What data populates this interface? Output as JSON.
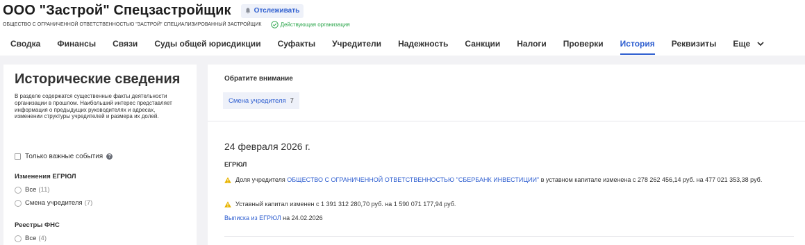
{
  "header": {
    "company_title": "ООО \"Застрой\" Спецзастройщик",
    "follow_label": "Отслеживать",
    "full_name": "ОБЩЕСТВО С ОГРАНИЧЕННОЙ ОТВЕТСТВЕННОСТЬЮ \"ЗАСТРОЙ\" СПЕЦИАЛИЗИРОВАННЫЙ ЗАСТРОЙЩИК",
    "status": "Действующая организация"
  },
  "nav": {
    "tabs": [
      {
        "label": "Сводка"
      },
      {
        "label": "Финансы"
      },
      {
        "label": "Связи"
      },
      {
        "label": "Суды общей юрисдикции"
      },
      {
        "label": "Суфакты"
      },
      {
        "label": "Учредители"
      },
      {
        "label": "Надежность"
      },
      {
        "label": "Санкции"
      },
      {
        "label": "Налоги"
      },
      {
        "label": "Проверки"
      },
      {
        "label": "История"
      },
      {
        "label": "Реквизиты"
      },
      {
        "label": "Еще"
      }
    ],
    "active_index": 10
  },
  "sidebar": {
    "title": "Исторические сведения",
    "description": "В разделе содержатся существенные факты деятельности организации в прошлом. Наибольший интерес представляет информация о предыдущих руководителях и адресах, изменении структуры учредителей и размера их долей.",
    "important_only_label": "Только важные события",
    "egrul": {
      "title": "Изменения ЕГРЮЛ",
      "options": [
        {
          "label": "Все",
          "count": "(11)"
        },
        {
          "label": "Смена учредителя",
          "count": "(7)"
        }
      ]
    },
    "fns": {
      "title": "Реестры ФНС",
      "options": [
        {
          "label": "Все",
          "count": "(4)"
        }
      ]
    }
  },
  "main": {
    "attention_title": "Обратите внимание",
    "attention_chip": {
      "label": "Смена учредителя",
      "count": "7"
    },
    "date": "24 февраля 2026 г.",
    "source": "ЕГРЮЛ",
    "events": [
      {
        "prefix": "Доля учредителя ",
        "link": "ОБЩЕСТВО С ОГРАНИЧЕННОЙ ОТВЕТСТВЕННОСТЬЮ \"СБЕРБАНК ИНВЕСТИЦИИ\"",
        "suffix": " в уставном капитале изменена с 278 262 456,14 руб. на 477 021 353,38 руб."
      },
      {
        "text": "Уставный капитал изменен с 1 391 312 280,70 руб. на 1 590 071 177,94 руб."
      }
    ],
    "extract_link": "Выписка из ЕГРЮЛ",
    "extract_suffix": " на 24.02.2026"
  },
  "colors": {
    "accent": "#2f5fd0",
    "status_green": "#2aa54a",
    "warning": "#e8b400"
  }
}
